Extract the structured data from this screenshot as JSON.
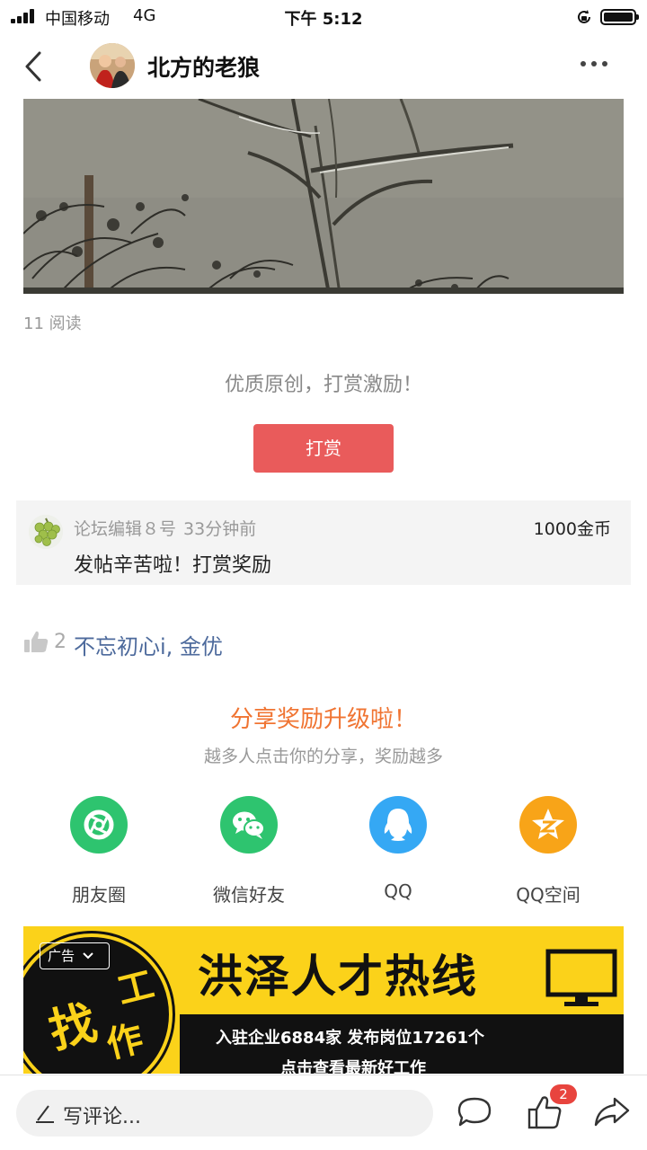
{
  "status_bar": {
    "carrier": "中国移动",
    "network": "4G",
    "time": "下午 5:12"
  },
  "header": {
    "author_name": "北方的老狼"
  },
  "post": {
    "read_count": "11 阅读",
    "reward_prompt": "优质原创，打赏激励！",
    "reward_button": "打赏"
  },
  "reward_record": {
    "user": "论坛编辑８号",
    "time": "33分钟前",
    "amount": "1000金币",
    "message": "发帖辛苦啦！打赏奖励"
  },
  "likes": {
    "count": "2",
    "users": "不忘初心i, 金优"
  },
  "share": {
    "title": "分享奖励升级啦！",
    "subtitle": "越多人点击你的分享，奖励越多",
    "targets": [
      {
        "label": "朋友圈",
        "icon": "moments-icon",
        "color": "#2ec46f"
      },
      {
        "label": "微信好友",
        "icon": "wechat-icon",
        "color": "#2ec46f"
      },
      {
        "label": "QQ",
        "icon": "qq-icon",
        "color": "#35a8f4"
      },
      {
        "label": "QQ空间",
        "icon": "qzone-icon",
        "color": "#f8a418"
      }
    ]
  },
  "ad": {
    "tag": "广告",
    "title": "洪泽人才热线",
    "stats": "入驻企业6884家  发布岗位17261个",
    "cta": "点击查看最新好工作",
    "badge_chars": [
      "找",
      "工",
      "作"
    ],
    "background": "#fbd21a"
  },
  "bottom_bar": {
    "comment_placeholder": "写评论...",
    "like_badge": "2"
  }
}
